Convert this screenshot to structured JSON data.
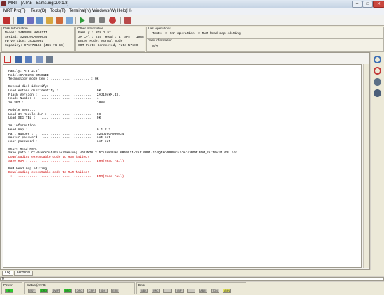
{
  "window": {
    "title": "MRT - [ATA5 - Samsung 2.0.1.8]",
    "minimize": "–",
    "maximize": "□",
    "close": "✕"
  },
  "menu": [
    "MRT Pro(F)",
    "Tests(D)",
    "Tools(T)",
    "Terminal(N)",
    "Windows(W)",
    "Help(H)"
  ],
  "disk_info": {
    "title": "Disk Information",
    "lines": [
      "Model: SAMSUNG HM501II",
      "Serial: S24QJ9CA000034",
      "Fw version: 2AJ10001",
      "Capacity: 976773168 (465.76 GB)"
    ]
  },
  "other_info": {
    "title": "Other Information",
    "lines": [
      "Family : MT8 2.5\"",
      "3A Cyl : 255  Head : 4  SPT : 1088",
      "Enter Mode: Normal mode",
      "COM Port: Connected, rate 57600"
    ]
  },
  "last_operations": {
    "title": "Last operations",
    "line": "Tests -> RAM operation -> RAM head map editing"
  },
  "task_info": {
    "title": "Task information",
    "line": "N/A"
  },
  "log": [
    {
      "text": "Family: MT8 2.5\"",
      "color": "#000000"
    },
    {
      "text": "Model:SAMSUNG HM501II",
      "color": "#000000"
    },
    {
      "text": "Technology mode key : .................... : OK",
      "color": "#000000"
    },
    {
      "text": "",
      "color": "#000000"
    },
    {
      "text": "Extend disk identify:",
      "color": "#000000"
    },
    {
      "text": "Load extend diskIdentify : ................ : OK",
      "color": "#000000"
    },
    {
      "text": "Flash Version : ........................... : 2AJ10vkM.d3l",
      "color": "#000000"
    },
    {
      "text": "Heads Number : ............................ : 4",
      "color": "#000000"
    },
    {
      "text": "3A SPT : .................................. : 1088",
      "color": "#000000"
    },
    {
      "text": "",
      "color": "#000000"
    },
    {
      "text": "Module menu...",
      "color": "#000000"
    },
    {
      "text": "Load 3A Module dir : ...................... : OK",
      "color": "#000000"
    },
    {
      "text": "Load SEG_TBL : ............................ : OK",
      "color": "#000000"
    },
    {
      "text": "",
      "color": "#000000"
    },
    {
      "text": "3A information...",
      "color": "#000000"
    },
    {
      "text": "Head map : ................................ : 0 1 2 3",
      "color": "#000000"
    },
    {
      "text": "Part Number : ............................. : S24QJ9CA000034",
      "color": "#000000"
    },
    {
      "text": "master password : ......................... : not set",
      "color": "#000000"
    },
    {
      "text": "user password : ........................... : not set",
      "color": "#000000"
    },
    {
      "text": "",
      "color": "#000000"
    },
    {
      "text": "Start Read ROM...",
      "color": "#000000"
    },
    {
      "text": "Save path : C:\\UsersDataFile\\Samsung HDD\\MT8 2.5\"\\SAMSUNG HM501II-2AJ10001-S24QJ9CA000034\\Data\\ROM\\ROM_2AJ10vkM.d3L.bin",
      "color": "#000000"
    },
    {
      "text": "Downloading executable code to RAM failed!",
      "color": "#cc0000"
    },
    {
      "text": "Save ROM : ................................ : ERR(Read Fail)",
      "color": "#cc0000"
    },
    {
      "text": "",
      "color": "#000000"
    },
    {
      "text": "RAM head map editing..",
      "color": "#000000"
    },
    {
      "text": "Downloading executable code to RAM failed!",
      "color": "#cc0000"
    },
    {
      "text": " : ........................................ : ERR(Read Fail)",
      "color": "#cc0000"
    }
  ],
  "tabs": [
    "Log",
    "Terminal"
  ],
  "progress": {
    "text": "0",
    "value": 0
  },
  "status": {
    "power": {
      "title": "Power",
      "leds": [
        {
          "label": "5V",
          "on": true
        }
      ]
    },
    "ata": {
      "title": "Status (ATA8)",
      "leds": [
        {
          "label": "BSY",
          "on": false
        },
        {
          "label": "DRD",
          "on": true
        },
        {
          "label": "DWF",
          "on": false
        },
        {
          "label": "DSC",
          "on": true
        },
        {
          "label": "DRQ",
          "on": false
        },
        {
          "label": "CRR",
          "on": false
        },
        {
          "label": "IDX",
          "on": false
        },
        {
          "label": "ERR",
          "on": false
        }
      ]
    },
    "error": {
      "title": "Error",
      "leds": [
        {
          "label": "BBK",
          "on": false
        },
        {
          "label": "UNC",
          "on": false
        },
        {
          "label": "",
          "on": false
        },
        {
          "label": "INF",
          "on": false
        },
        {
          "label": "",
          "on": false
        },
        {
          "label": "ABR",
          "on": false
        },
        {
          "label": "TON",
          "on": false
        },
        {
          "label": "AMN",
          "on": false,
          "warn": true
        }
      ]
    }
  },
  "colors": {
    "led_on": "#2ec82e",
    "led_off": "#cdcac0",
    "led_warn": "#e6e65a",
    "error_text": "#cc0000"
  }
}
